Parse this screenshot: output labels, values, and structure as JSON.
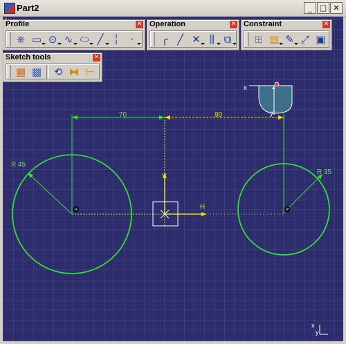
{
  "window": {
    "title": "Part2",
    "minimize": "_",
    "maximize": "□",
    "close": "✕"
  },
  "toolbars": {
    "profile": {
      "title": "Profile",
      "close": "✕"
    },
    "operation": {
      "title": "Operation",
      "close": "✕"
    },
    "constraint": {
      "title": "Constraint",
      "close": "✕"
    },
    "sketch_tools": {
      "title": "Sketch tools",
      "close": "✕"
    }
  },
  "sketch": {
    "dimensions": {
      "horizontal_left": "70",
      "horizontal_right": "90",
      "radius_left": "R 45",
      "radius_right": "R 35"
    },
    "axis": {
      "h_label": "H",
      "v_label": "V"
    },
    "compass": {
      "x_label": "x",
      "y_label": "y",
      "z_label": "z"
    },
    "corner_axes": {
      "x_label": "x",
      "y_label": "y"
    }
  },
  "colors": {
    "background": "#2d2d6e",
    "grid": "#4a4a8a",
    "geometry": "#33dd33",
    "construction": "#e8e000",
    "dimension": "#7fd86a",
    "compass_fill": "#3f6e8a"
  }
}
